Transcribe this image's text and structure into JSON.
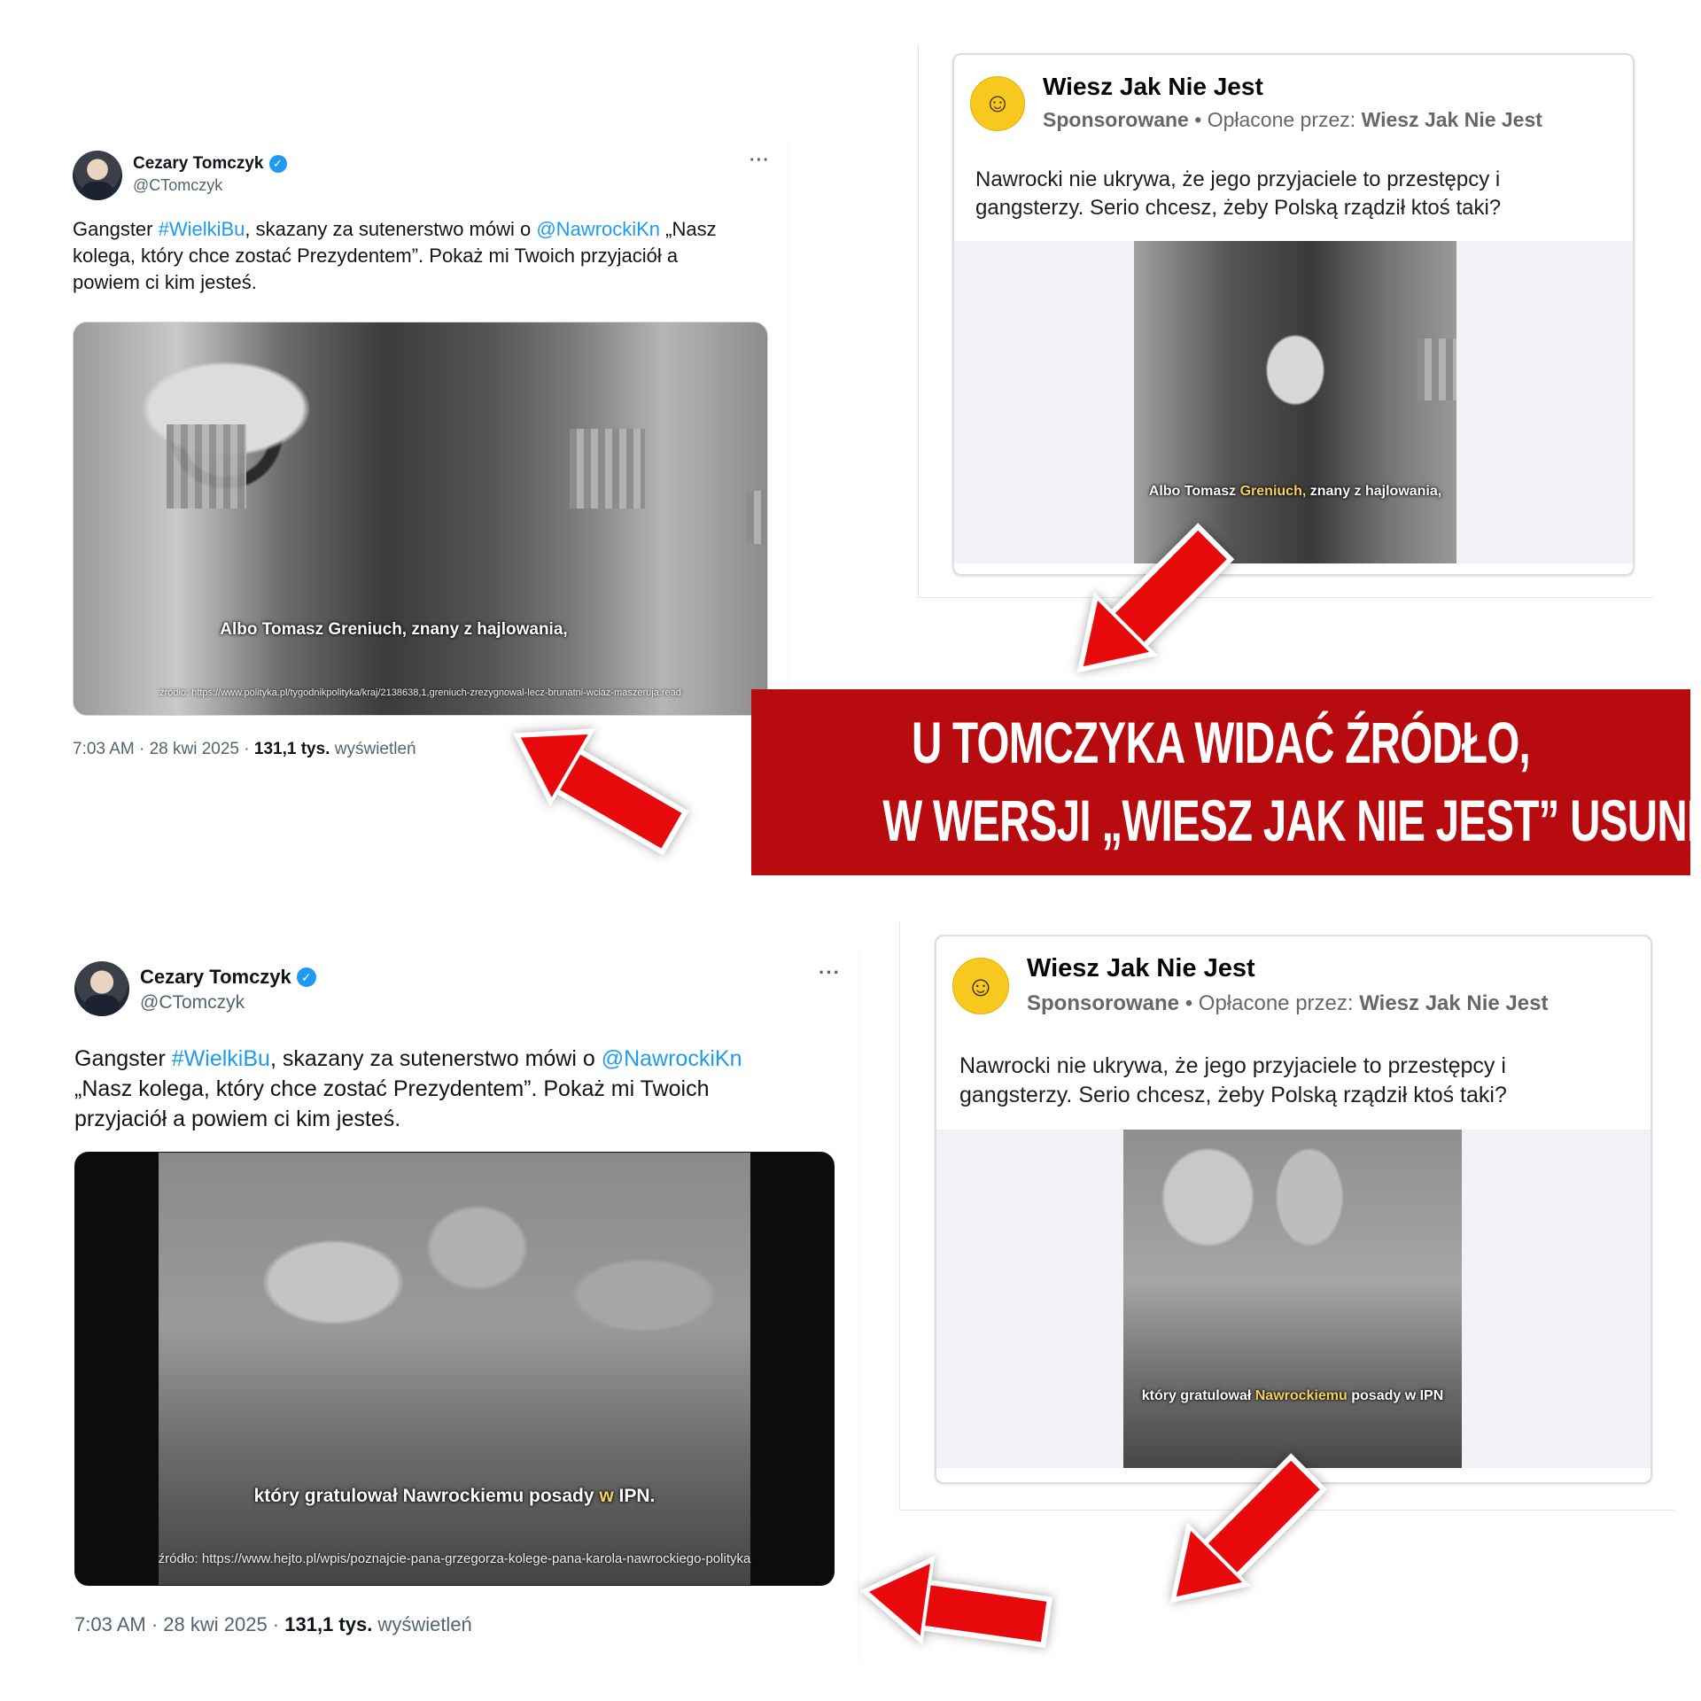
{
  "tweet": {
    "author": "Cezary Tomczyk",
    "handle": "@CTomczyk",
    "more": "···",
    "text_pre": "Gangster ",
    "hashtag": "#WielkiBu",
    "text_mid": ", skazany za sutenerstwo mówi o ",
    "mention": "@NawrockiKn",
    "text_post": " „Nasz kolega, który chce zostać Prezydentem”. Pokaż mi Twoich przyjaciół a powiem ci kim jesteś.",
    "time": "7:03 AM · 28 kwi 2025 · ",
    "views": "131,1 tys.",
    "views_label": " wyświetleń"
  },
  "tweet1_photo": {
    "caption_pre": "Albo Tomasz Greniuch, znany z hajlowania,",
    "source": "źródło: https://www.polityka.pl/tygodnikpolityka/kraj/2138638,1,greniuch-zrezygnowal-lecz-brunatni-wciaz-maszeruja.read"
  },
  "tweet2_photo": {
    "caption_pre": "który gratulował ",
    "caption_hl": "Nawrockiemu posady",
    "caption_mid": " w ",
    "caption_post": "IPN.",
    "source": "źródło: https://www.hejto.pl/wpis/poznajcie-pana-grzegorza-kolege-pana-karola-nawrockiego-polityka"
  },
  "ad": {
    "page_name": "Wiesz Jak Nie Jest",
    "sponsored": "Sponsorowane",
    "dot": " • ",
    "paid_by_label": "Opłacone przez: ",
    "paid_by": "Wiesz Jak Nie Jest",
    "text": "Nawrocki nie ukrywa, że jego przyjaciele to przestępcy i gangsterzy. Serio chcesz, żeby Polską rządził ktoś taki?"
  },
  "ad1_photo": {
    "caption_pre": "Albo Tomasz ",
    "caption_hl": "Greniuch,",
    "caption_post": " znany z hajlowania,"
  },
  "ad2_photo": {
    "caption_pre": "który gratulował ",
    "caption_hl": "Nawrockiemu",
    "caption_post": " posady w IPN"
  },
  "banner": {
    "line1": "U TOMCZYKA WIDAĆ ŹRÓDŁO,",
    "line2": "W WERSJI „WIESZ JAK NIE JEST” USUNIĘTE",
    "color": "#b80b10"
  },
  "icons": {
    "verified": "verified-badge-icon",
    "more": "more-options-icon",
    "arrow": "red-arrow-icon"
  },
  "colors": {
    "link": "#1d9bf0",
    "arrow": "#e8090c",
    "highlight": "#f4d35e"
  }
}
